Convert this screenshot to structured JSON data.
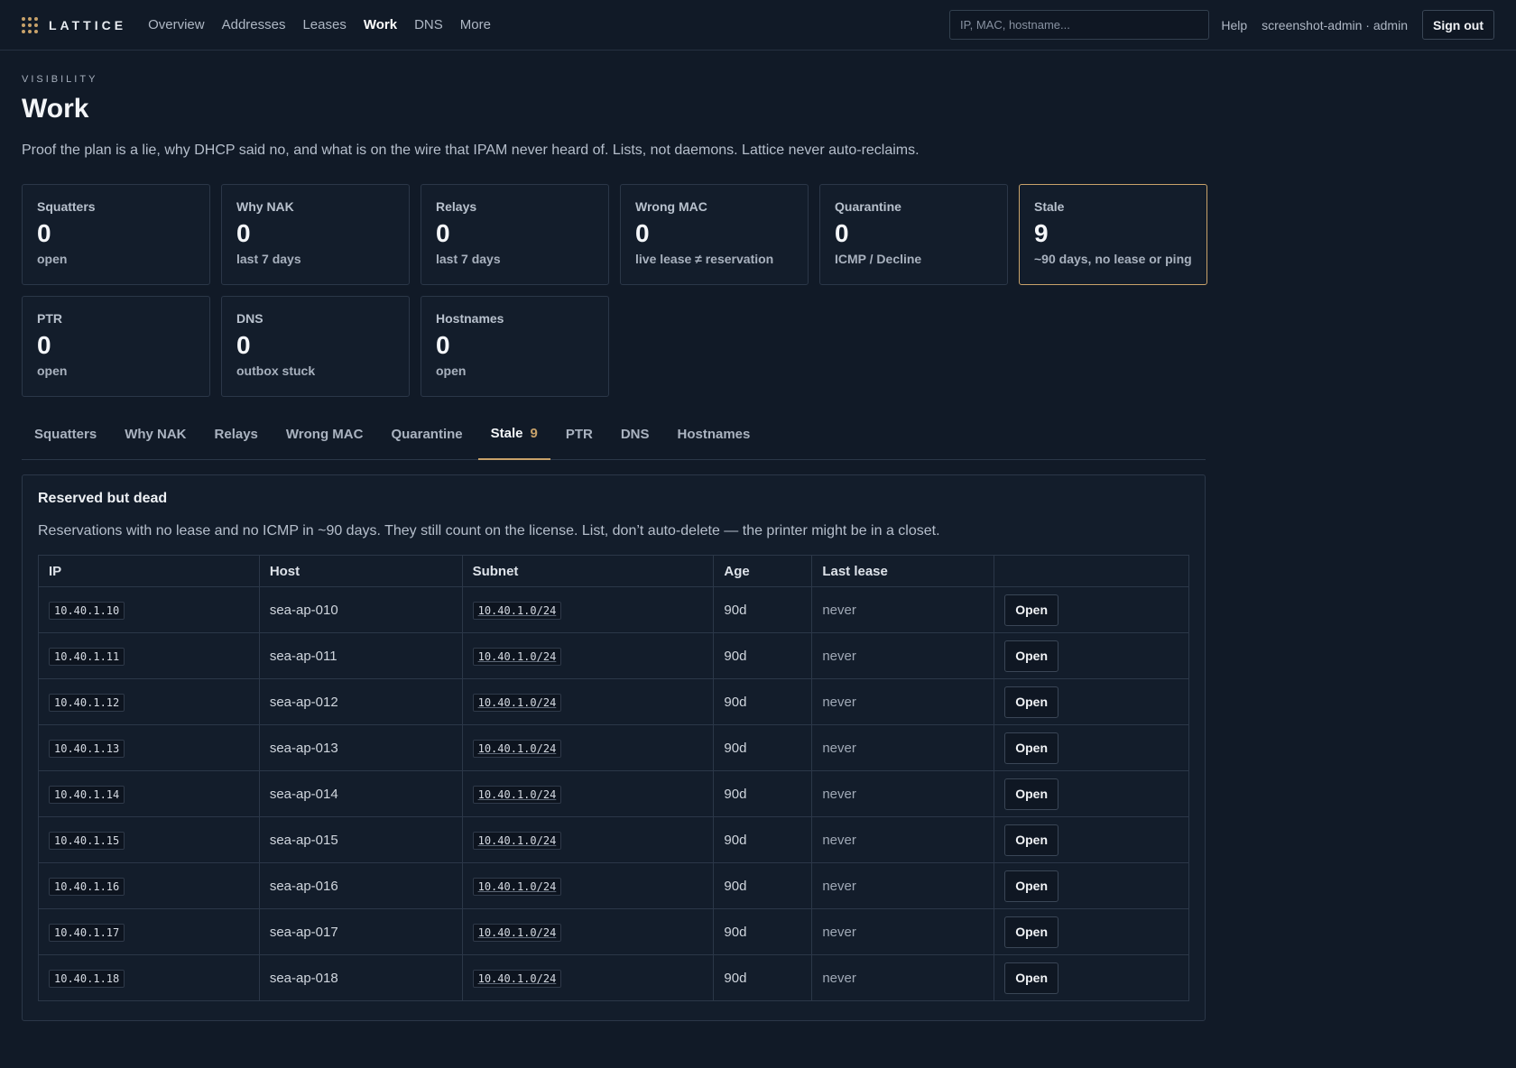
{
  "brand": {
    "name": "LATTICE",
    "accent": "#c8a26a"
  },
  "nav": [
    {
      "label": "Overview",
      "active": false
    },
    {
      "label": "Addresses",
      "active": false
    },
    {
      "label": "Leases",
      "active": false
    },
    {
      "label": "Work",
      "active": true
    },
    {
      "label": "DNS",
      "active": false
    },
    {
      "label": "More",
      "active": false
    }
  ],
  "search": {
    "placeholder": "IP, MAC, hostname..."
  },
  "user": {
    "help_label": "Help",
    "identity": "screenshot-admin · admin",
    "signout_label": "Sign out"
  },
  "header": {
    "eyebrow": "VISIBILITY",
    "title": "Work",
    "subtitle": "Proof the plan is a lie, why DHCP said no, and what is on the wire that IPAM never heard of. Lists, not daemons. Lattice never auto-reclaims."
  },
  "cards": [
    {
      "label": "Squatters",
      "value": "0",
      "sub": "open",
      "active": false
    },
    {
      "label": "Why NAK",
      "value": "0",
      "sub": "last 7 days",
      "active": false
    },
    {
      "label": "Relays",
      "value": "0",
      "sub": "last 7 days",
      "active": false
    },
    {
      "label": "Wrong MAC",
      "value": "0",
      "sub": "live lease ≠ reservation",
      "active": false
    },
    {
      "label": "Quarantine",
      "value": "0",
      "sub": "ICMP / Decline",
      "active": false
    },
    {
      "label": "Stale",
      "value": "9",
      "sub": "~90 days, no lease or ping",
      "active": true
    },
    {
      "label": "PTR",
      "value": "0",
      "sub": "open",
      "active": false
    },
    {
      "label": "DNS",
      "value": "0",
      "sub": "outbox stuck",
      "active": false
    },
    {
      "label": "Hostnames",
      "value": "0",
      "sub": "open",
      "active": false
    }
  ],
  "tabs": [
    {
      "label": "Squatters",
      "count": "",
      "active": false
    },
    {
      "label": "Why NAK",
      "count": "",
      "active": false
    },
    {
      "label": "Relays",
      "count": "",
      "active": false
    },
    {
      "label": "Wrong MAC",
      "count": "",
      "active": false
    },
    {
      "label": "Quarantine",
      "count": "",
      "active": false
    },
    {
      "label": "Stale",
      "count": "9",
      "active": true
    },
    {
      "label": "PTR",
      "count": "",
      "active": false
    },
    {
      "label": "DNS",
      "count": "",
      "active": false
    },
    {
      "label": "Hostnames",
      "count": "",
      "active": false
    }
  ],
  "panel": {
    "title": "Reserved but dead",
    "description": "Reservations with no lease and no ICMP in ~90 days. They still count on the license. List, don’t auto-delete — the printer might be in a closet.",
    "columns": [
      "IP",
      "Host",
      "Subnet",
      "Age",
      "Last lease",
      ""
    ],
    "open_label": "Open",
    "rows": [
      {
        "ip": "10.40.1.10",
        "host": "sea-ap-010",
        "subnet": "10.40.1.0/24",
        "age": "90d",
        "last_lease": "never"
      },
      {
        "ip": "10.40.1.11",
        "host": "sea-ap-011",
        "subnet": "10.40.1.0/24",
        "age": "90d",
        "last_lease": "never"
      },
      {
        "ip": "10.40.1.12",
        "host": "sea-ap-012",
        "subnet": "10.40.1.0/24",
        "age": "90d",
        "last_lease": "never"
      },
      {
        "ip": "10.40.1.13",
        "host": "sea-ap-013",
        "subnet": "10.40.1.0/24",
        "age": "90d",
        "last_lease": "never"
      },
      {
        "ip": "10.40.1.14",
        "host": "sea-ap-014",
        "subnet": "10.40.1.0/24",
        "age": "90d",
        "last_lease": "never"
      },
      {
        "ip": "10.40.1.15",
        "host": "sea-ap-015",
        "subnet": "10.40.1.0/24",
        "age": "90d",
        "last_lease": "never"
      },
      {
        "ip": "10.40.1.16",
        "host": "sea-ap-016",
        "subnet": "10.40.1.0/24",
        "age": "90d",
        "last_lease": "never"
      },
      {
        "ip": "10.40.1.17",
        "host": "sea-ap-017",
        "subnet": "10.40.1.0/24",
        "age": "90d",
        "last_lease": "never"
      },
      {
        "ip": "10.40.1.18",
        "host": "sea-ap-018",
        "subnet": "10.40.1.0/24",
        "age": "90d",
        "last_lease": "never"
      }
    ]
  }
}
